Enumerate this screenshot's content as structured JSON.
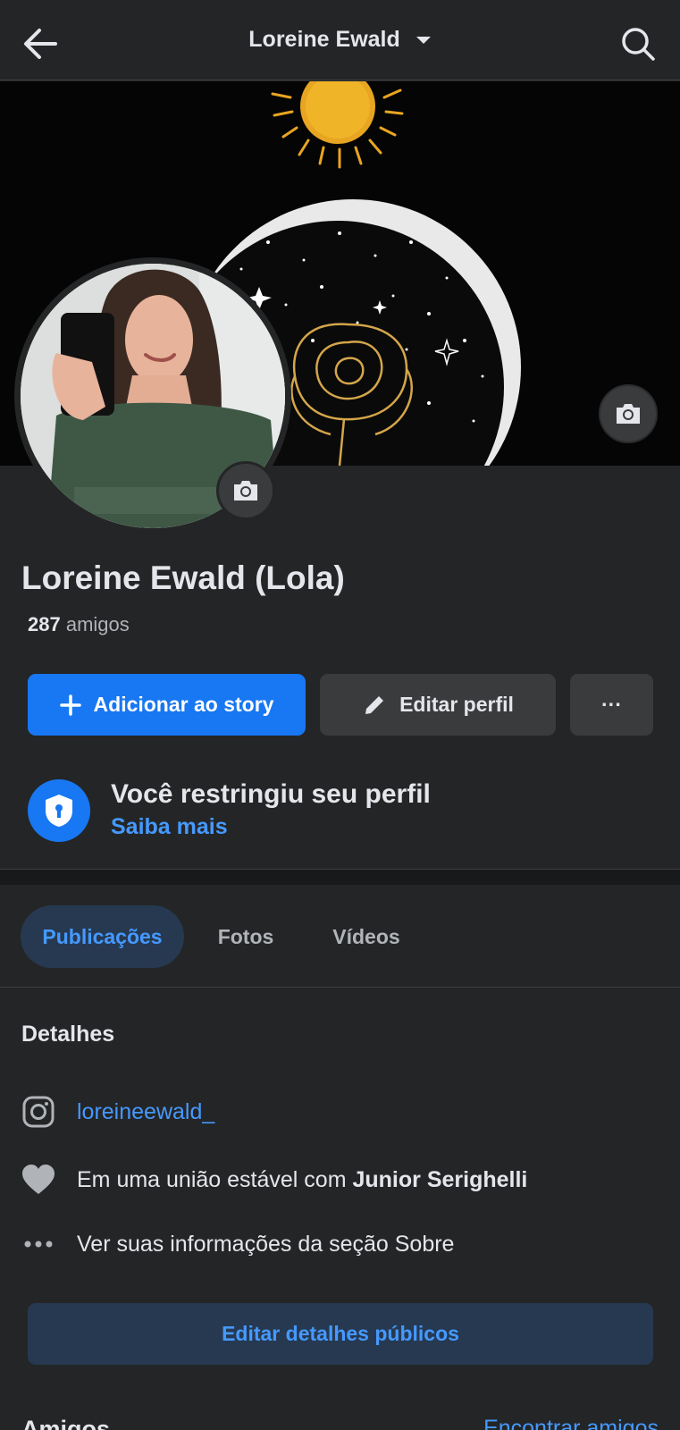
{
  "header": {
    "title": "Loreine Ewald",
    "back_icon": "arrow-left-icon",
    "search_icon": "search-icon"
  },
  "profile": {
    "name": "Loreine Ewald (Lola)",
    "friends_count": "287",
    "friends_label": "amigos"
  },
  "actions": {
    "story_label": "Adicionar ao story",
    "edit_label": "Editar perfil",
    "more_label": "···"
  },
  "privacy": {
    "title": "Você restringiu seu perfil",
    "link": "Saiba mais"
  },
  "tabs": [
    {
      "label": "Publicações",
      "active": true
    },
    {
      "label": "Fotos",
      "active": false
    },
    {
      "label": "Vídeos",
      "active": false
    }
  ],
  "details": {
    "title": "Detalhes",
    "instagram": "loreineewald_",
    "relationship_prefix": "Em uma união estável com ",
    "relationship_partner": "Junior Serighelli",
    "about": "Ver suas informações da seção Sobre",
    "edit_button": "Editar detalhes públicos"
  },
  "friends_section": {
    "title": "Amigos",
    "find_link": "Encontrar amigos"
  },
  "colors": {
    "background": "#242526",
    "accent": "#1877f2",
    "link": "#4599ff",
    "secondary_button": "#3a3b3c",
    "active_tab_bg": "#263951"
  }
}
